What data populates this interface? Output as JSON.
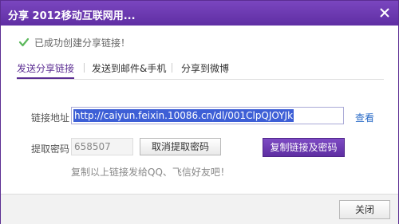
{
  "dialog": {
    "title": "分享 2012移动互联网用...",
    "close_icon": "close-icon"
  },
  "status": {
    "icon": "check-icon",
    "text": "已成功创建分享链接！",
    "color": "#5cb85c"
  },
  "tabs": [
    {
      "label": "发送分享链接",
      "active": true
    },
    {
      "label": "发送到邮件&手机",
      "active": false
    },
    {
      "label": "分享到微博",
      "active": false
    }
  ],
  "link": {
    "label": "链接地址",
    "value": "http://caiyun.feixin.10086.cn/dl/001ClpQJOYJk",
    "view_label": "查看"
  },
  "code": {
    "label": "提取密码",
    "value": "658507",
    "cancel_label": "取消提取密码",
    "copy_label": "复制链接及密码"
  },
  "hint": "复制以上链接发给QQ、飞信好友吧！",
  "footer": {
    "close_label": "关闭"
  },
  "colors": {
    "accent": "#5b2d92",
    "link": "#2a6bc7"
  }
}
